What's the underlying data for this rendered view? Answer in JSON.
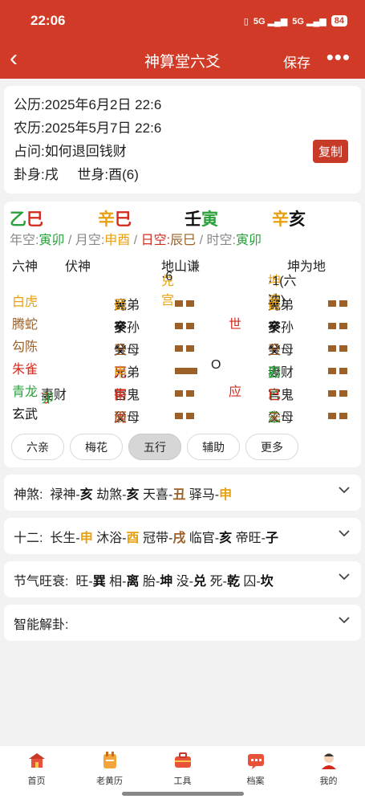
{
  "status": {
    "time": "22:06",
    "battery": "84"
  },
  "nav": {
    "title": "神算堂六爻",
    "save": "保存",
    "more": "•••"
  },
  "info": {
    "solar_label": "公历:",
    "solar": "2025年6月2日 22:6",
    "lunar_label": "农历:",
    "lunar": "2025年5月7日 22:6",
    "question_label": "占问:",
    "question": "如何退回钱财",
    "copy": "复制",
    "guashen_label": "卦身:",
    "guashen": "戌",
    "shishen_label": "世身:",
    "shishen": "酉(6)"
  },
  "pillars": [
    {
      "stem": "乙",
      "branch": "巳"
    },
    {
      "stem": "辛",
      "branch": "巳"
    },
    {
      "stem": "壬",
      "branch": "寅"
    },
    {
      "stem": "辛",
      "branch": "亥"
    }
  ],
  "kong": {
    "year_label": "年空:",
    "year": "寅卯",
    "sep1": "/",
    "month_label": "月空:",
    "month": "申酉",
    "sep2": "/",
    "day_label": "日空:",
    "day": "辰巳",
    "sep3": "/",
    "hour_label": "时空:",
    "hour": "寅卯"
  },
  "header": {
    "liushen": "六神",
    "fushen": "伏神",
    "main_name": "地山谦",
    "main_palace_a": "兑宫",
    "main_palace_b": "·6",
    "change_name": "坤为地",
    "change_palace_a": "坤宫",
    "change_palace_b": "·1(六冲)"
  },
  "lines": [
    {
      "spirit": "白虎",
      "fu_a": "",
      "fu_b": "",
      "kin": "兄弟",
      "stem": "癸",
      "branch": "酉",
      "yao": "yin",
      "move": "",
      "mark": "",
      "ckin": "兄弟",
      "cstem": "癸",
      "cbranch": "酉",
      "cyao": "yin"
    },
    {
      "spirit": "腾蛇",
      "fu_a": "",
      "fu_b": "",
      "kin": "子孙",
      "stem": "癸",
      "branch": "亥",
      "yao": "yin",
      "move": "",
      "mark": "世",
      "ckin": "子孙",
      "cstem": "癸",
      "cbranch": "亥",
      "cyao": "yin"
    },
    {
      "spirit": "勾陈",
      "fu_a": "",
      "fu_b": "",
      "kin": "父母",
      "stem": "癸",
      "branch": "丑",
      "yao": "yin",
      "move": "",
      "mark": "",
      "ckin": "父母",
      "cstem": "癸",
      "cbranch": "丑",
      "cyao": "yin"
    },
    {
      "spirit": "朱雀",
      "fu_a": "",
      "fu_b": "",
      "kin": "兄弟",
      "stem": "丙",
      "branch": "申",
      "yao": "yang",
      "move": "O",
      "mark": "",
      "ckin": "妻财",
      "cstem": "乙",
      "cbranch": "卯",
      "cyao": "yin"
    },
    {
      "spirit": "青龙",
      "fu_a": "妻财",
      "fu_b": "丁卯",
      "kin": "官鬼",
      "stem": "丙",
      "branch": "午",
      "yao": "yin",
      "move": "",
      "mark": "应",
      "ckin": "官鬼",
      "cstem": "乙",
      "cbranch": "巳",
      "cyao": "yin"
    },
    {
      "spirit": "玄武",
      "fu_a": "",
      "fu_b": "",
      "kin": "父母",
      "stem": "丙",
      "branch": "辰",
      "yao": "yin",
      "move": "",
      "mark": "",
      "ckin": "父母",
      "cstem": "乙",
      "cbranch": "未",
      "cyao": "yin"
    }
  ],
  "buttons": [
    "六亲",
    "梅花",
    "五行",
    "辅助",
    "更多"
  ],
  "shensha": {
    "label": "神煞:",
    "items": [
      {
        "name": "禄神-",
        "val": "亥"
      },
      {
        "name": "劫煞-",
        "val": "亥"
      },
      {
        "name": "天喜-",
        "val": "丑"
      },
      {
        "name": "驿马-",
        "val": "申"
      }
    ]
  },
  "twelve": {
    "label": "十二:",
    "items": [
      {
        "name": "长生-",
        "val": "申"
      },
      {
        "name": "沐浴-",
        "val": "酉"
      },
      {
        "name": "冠带-",
        "val": "戌"
      },
      {
        "name": "临官-",
        "val": "亥"
      },
      {
        "name": "帝旺-",
        "val": "子"
      }
    ]
  },
  "jieqi": {
    "label": "节气旺衰:",
    "items": [
      {
        "name": "旺-",
        "val": "巽"
      },
      {
        "name": "相-",
        "val": "离"
      },
      {
        "name": "胎-",
        "val": "坤"
      },
      {
        "name": "没-",
        "val": "兑"
      },
      {
        "name": "死-",
        "val": "乾"
      },
      {
        "name": "囚-",
        "val": "坎"
      }
    ]
  },
  "ai": {
    "label": "智能解卦:"
  },
  "tabs": [
    {
      "label": "首页",
      "icon": "home-icon"
    },
    {
      "label": "老黄历",
      "icon": "almanac-icon"
    },
    {
      "label": "工具",
      "icon": "toolbox-icon"
    },
    {
      "label": "档案",
      "icon": "archive-icon"
    },
    {
      "label": "我的",
      "icon": "profile-icon"
    }
  ],
  "colors": {
    "brand": "#d03a26",
    "wood": "#2ca03c",
    "metal": "#e8a010",
    "fire": "#d42a1c",
    "water": "#111111",
    "earth": "#9c6028"
  }
}
